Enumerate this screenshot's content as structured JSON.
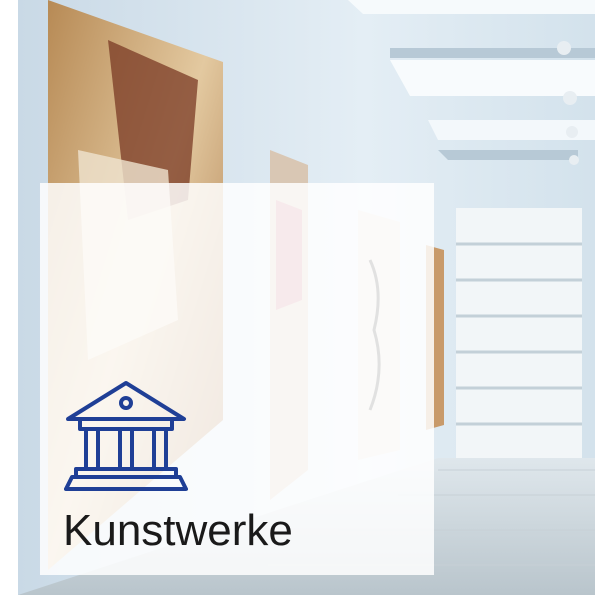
{
  "tile": {
    "label": "Kunstwerke",
    "icon": "museum-building-icon",
    "label_color": "#1a1a1a",
    "icon_color": "#1f3f96",
    "overlay_color": "#ffffff"
  }
}
